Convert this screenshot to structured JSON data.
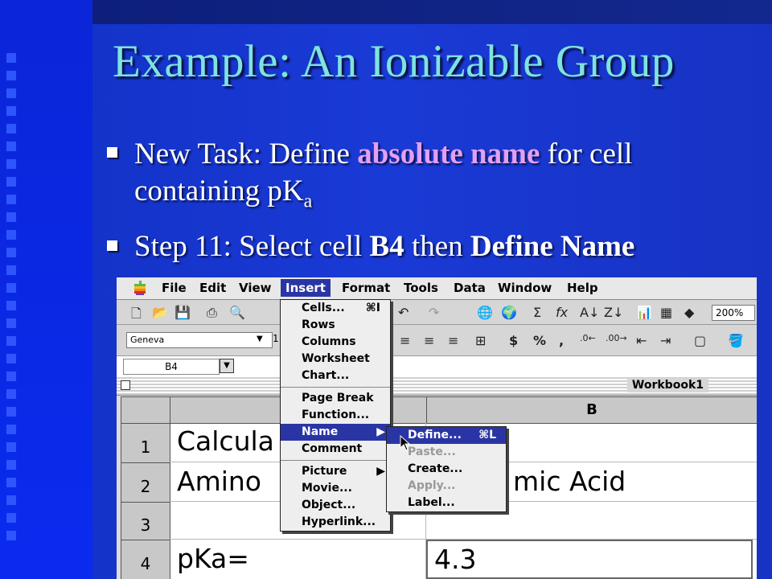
{
  "slide": {
    "title": "Example: An Ionizable Group",
    "bullet1": {
      "pre": "New Task: Define ",
      "highlight": "absolute name",
      "post": " for cell",
      "line2": "containing pK",
      "sub": "a"
    },
    "bullet2": {
      "pre": "Step 11: Select cell ",
      "cell": "B4",
      "mid": " then ",
      "action": "Define Name"
    }
  },
  "menubar": [
    "File",
    "Edit",
    "View",
    "Insert",
    "Format",
    "Tools",
    "Data",
    "Window",
    "Help"
  ],
  "toolbar": {
    "zoom": "200%",
    "font": "Geneva",
    "size": "1"
  },
  "namebox": {
    "ref": "B4"
  },
  "workbook": {
    "title": "Workbook1"
  },
  "grid": {
    "columns": [
      "",
      "B"
    ],
    "rows": [
      "1",
      "2",
      "3",
      "4"
    ],
    "cells": {
      "A1": "Calcula",
      "A2": "Amino",
      "B2": "mic Acid",
      "A4": "pKa=",
      "B4": "4.3"
    }
  },
  "insert_menu": {
    "group1": [
      {
        "label": "Cells...",
        "shortcut": "⌘I"
      },
      {
        "label": "Rows"
      },
      {
        "label": "Columns"
      },
      {
        "label": "Worksheet"
      },
      {
        "label": "Chart..."
      }
    ],
    "group2": [
      {
        "label": "Page Break"
      },
      {
        "label": "Function..."
      },
      {
        "label": "Name"
      },
      {
        "label": "Comment"
      }
    ],
    "group3": [
      {
        "label": "Picture"
      },
      {
        "label": "Movie..."
      },
      {
        "label": "Object..."
      },
      {
        "label": "Hyperlink..."
      }
    ]
  },
  "name_submenu": [
    {
      "label": "Define...",
      "shortcut": "⌘L"
    },
    {
      "label": "Paste..."
    },
    {
      "label": "Create..."
    },
    {
      "label": "Apply..."
    },
    {
      "label": "Label..."
    }
  ],
  "colors": {
    "title": "#7fe3de",
    "highlight": "#e2a0f4",
    "menu_select": "#2a35a5"
  }
}
